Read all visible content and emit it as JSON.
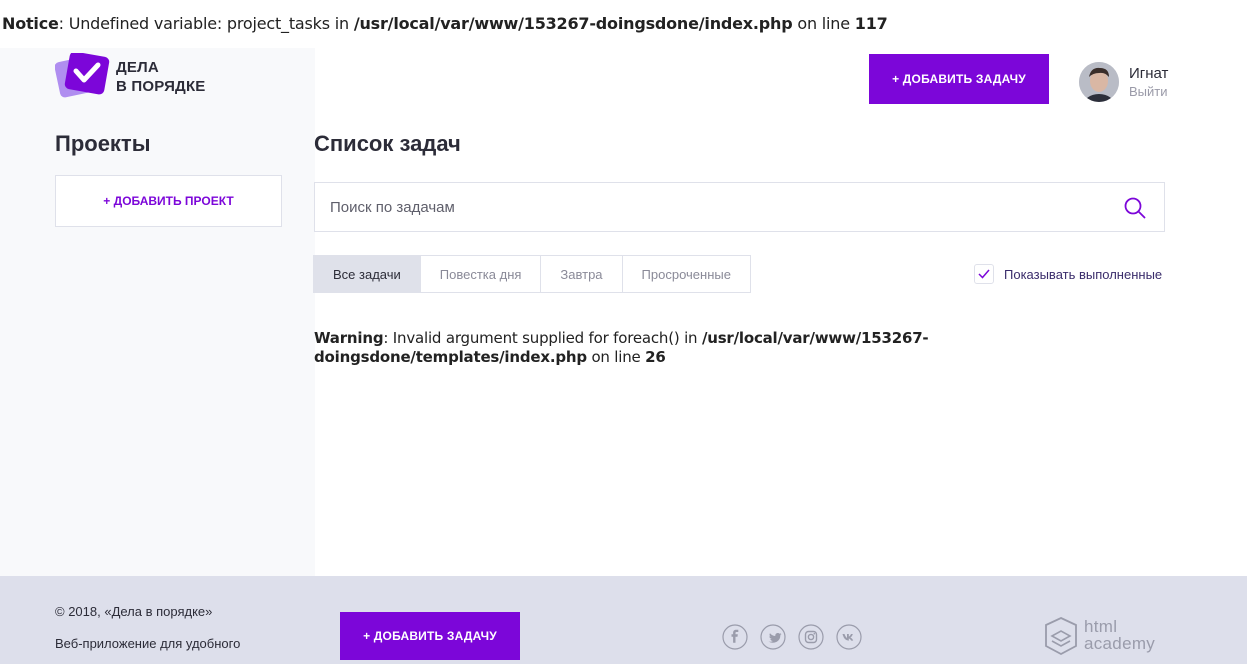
{
  "notice": {
    "label": "Notice",
    "message": ": Undefined variable: project_tasks in ",
    "path": "/usr/local/var/www/153267-doingsdone/index.php",
    "on_line": " on line ",
    "line": "117"
  },
  "logo": {
    "line1": "Дела",
    "line2": "в порядке"
  },
  "header": {
    "add_task_label": "+ Добавить задачу"
  },
  "user": {
    "name": "Игнат",
    "logout_label": "Выйти"
  },
  "sidebar": {
    "title": "Проекты",
    "add_project_label": "+ Добавить проект"
  },
  "main": {
    "title": "Список задач",
    "search": {
      "placeholder": "Поиск по задачам",
      "value": ""
    },
    "filters": [
      "Все задачи",
      "Повестка дня",
      "Завтра",
      "Просроченные"
    ],
    "active_filter": "Все задачи",
    "show_completed": {
      "label": "Показывать выполненные",
      "checked": true
    }
  },
  "warning": {
    "label": "Warning",
    "message": ": Invalid argument supplied for foreach() in ",
    "path": "/usr/local/var/www/153267-doingsdone/templates/index.php",
    "on_line": " on line ",
    "line": "26"
  },
  "footer": {
    "copyright": "© 2018, «Дела в порядке»",
    "description": "Веб-приложение для удобного",
    "add_task_label": "+ Добавить задачу",
    "social": [
      "facebook-icon",
      "twitter-icon",
      "instagram-icon",
      "vk-icon"
    ],
    "partner_logo": {
      "line1": "html",
      "line2": "academy"
    }
  },
  "colors": {
    "accent": "#7c06d9",
    "footer_bg": "#dddfeb",
    "sidebar_bg": "#f8f9fb"
  }
}
